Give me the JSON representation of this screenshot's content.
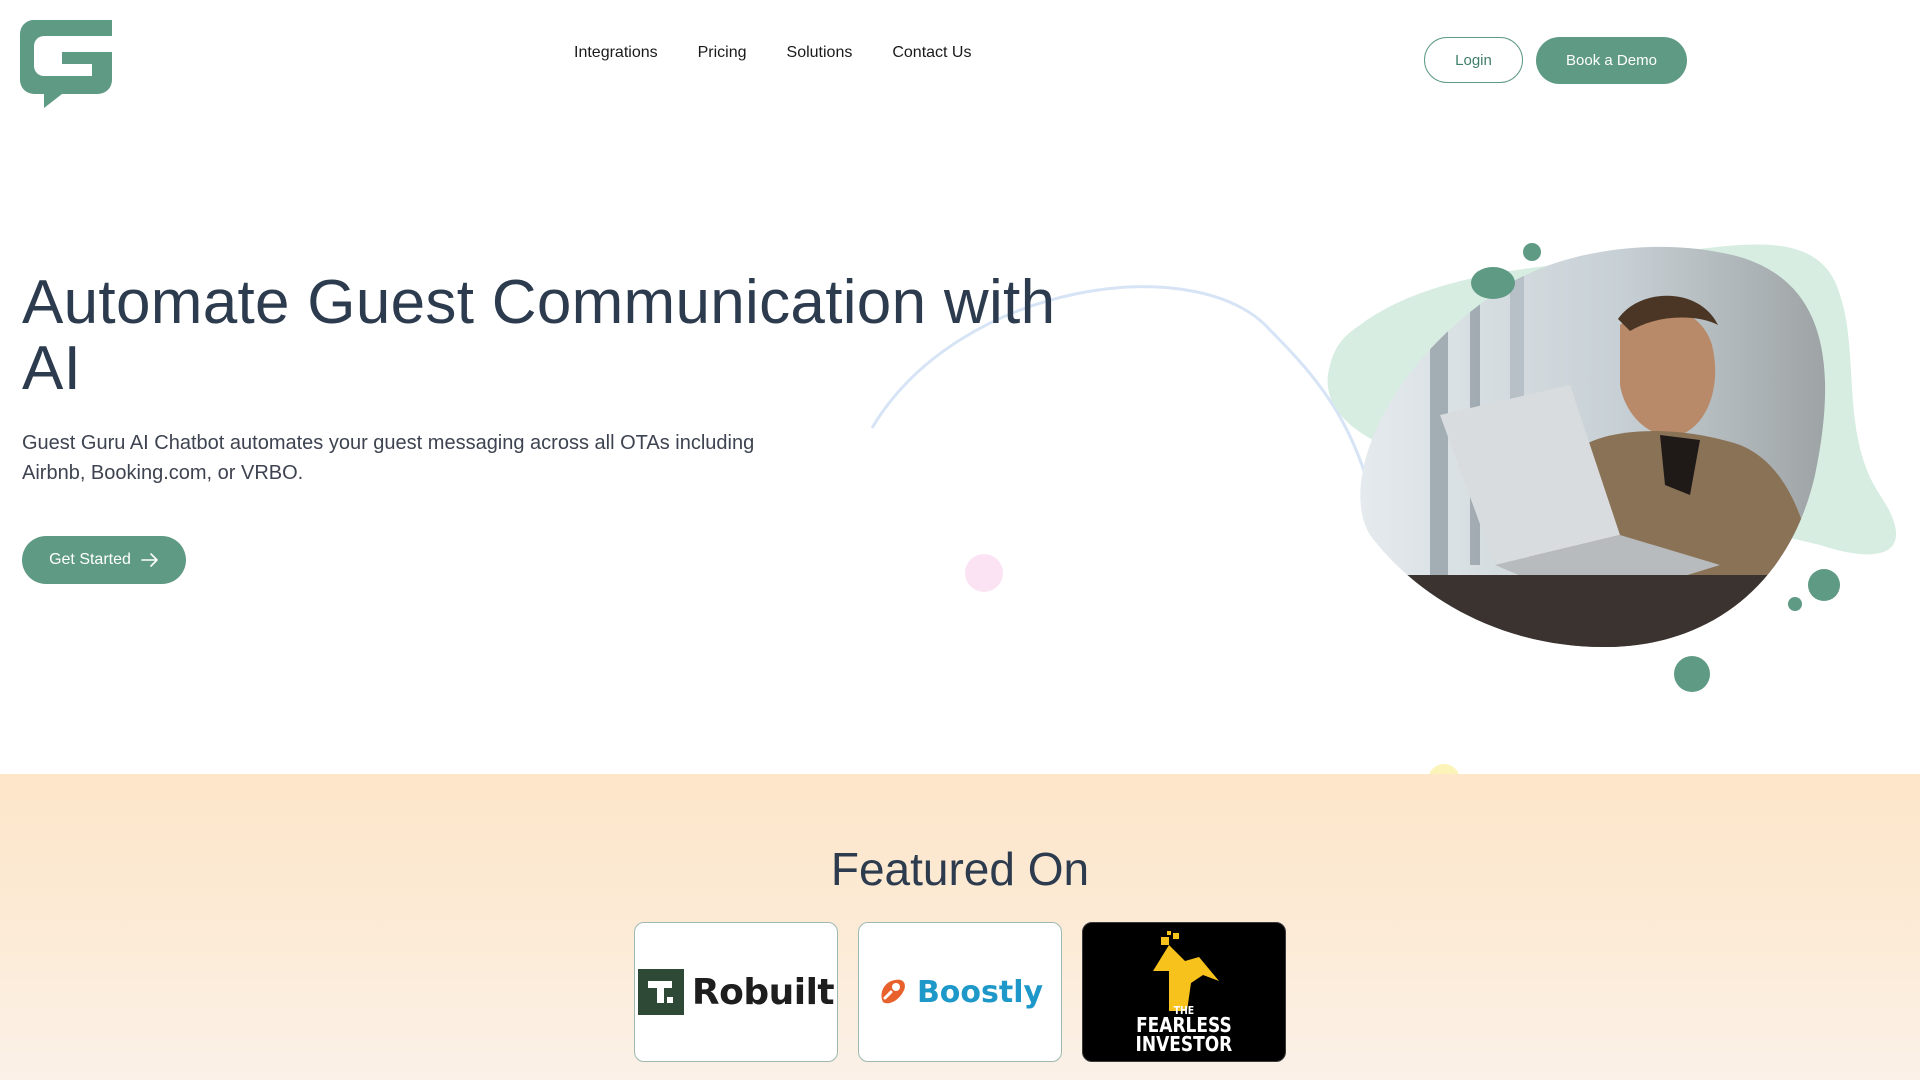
{
  "header": {
    "logo_name": "guest-guru-logo",
    "nav": [
      {
        "label": "Integrations"
      },
      {
        "label": "Pricing"
      },
      {
        "label": "Solutions"
      },
      {
        "label": "Contact Us"
      }
    ],
    "login_label": "Login",
    "demo_label": "Book a Demo"
  },
  "hero": {
    "title": "Automate Guest Communication with AI",
    "subtitle": "Guest Guru AI Chatbot automates your guest messaging across all OTAs including Airbnb, Booking.com, or VRBO.",
    "cta_label": "Get Started",
    "cta_icon": "arrow-right-icon",
    "image": "man-using-laptop-photo"
  },
  "featured": {
    "title": "Featured On",
    "logos": [
      {
        "name": "Robuilt",
        "icon": "robuilt-logo"
      },
      {
        "name": "Boostly",
        "icon": "boostly-logo"
      },
      {
        "name_line1": "THE",
        "name_line2": "FEARLESS",
        "name_line3": "INVESTOR",
        "icon": "fearless-investor-logo"
      }
    ]
  },
  "colors": {
    "brand_green": "#5e9a84",
    "mint_blob": "#d7ede2",
    "heading": "#2d3b4e",
    "featured_bg": "#fde6c9",
    "boostly_blue": "#1e98c8",
    "boostly_orange": "#e8612c",
    "fearless_yellow": "#f7c21b"
  }
}
